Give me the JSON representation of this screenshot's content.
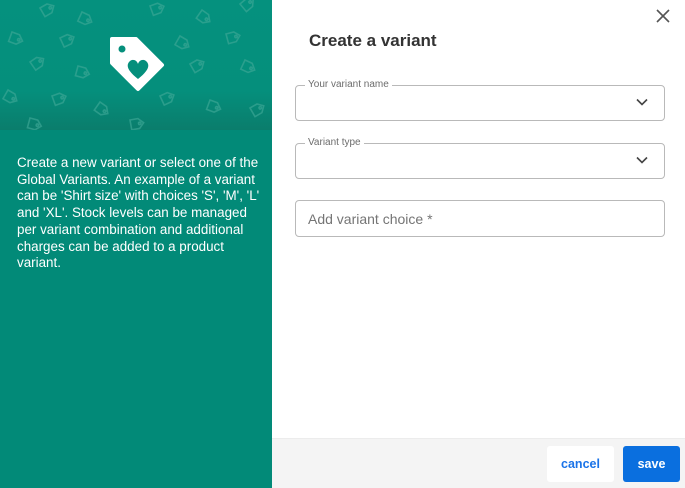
{
  "sidebar": {
    "description": "Create a new variant or select one of the Global Variants. An example of a variant can be 'Shirt size' with choices 'S', 'M', 'L' and 'XL'. Stock levels can be managed per variant combination and additional charges can be added to a product variant.",
    "hero_icon": "tag-heart-icon",
    "background_color": "#028a78"
  },
  "dialog": {
    "title": "Create a variant",
    "close_icon": "close-icon",
    "fields": {
      "variant_name": {
        "label": "Your variant name",
        "value": ""
      },
      "variant_type": {
        "label": "Variant type",
        "value": ""
      },
      "variant_choice": {
        "placeholder": "Add variant choice *",
        "value": ""
      }
    },
    "footer": {
      "cancel_label": "cancel",
      "save_label": "save",
      "accent_color": "#0a6fdf"
    }
  }
}
